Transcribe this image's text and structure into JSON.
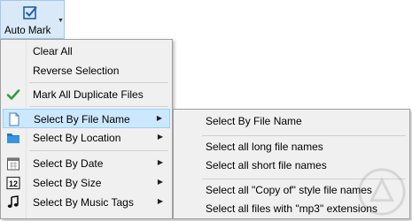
{
  "ribbon": {
    "auto_mark_label": "Auto Mark"
  },
  "menu": {
    "items": [
      {
        "label": "Clear All"
      },
      {
        "label": "Reverse Selection"
      },
      {
        "label": "Mark All Duplicate Files"
      },
      {
        "label": "Select By File Name"
      },
      {
        "label": "Select By Location"
      },
      {
        "label": "Select By Date"
      },
      {
        "label": "Select By Size"
      },
      {
        "label": "Select By Music Tags"
      }
    ]
  },
  "submenu": {
    "items": [
      {
        "label": "Select By File Name"
      },
      {
        "label": "Select all long file names"
      },
      {
        "label": "Select all short file names"
      },
      {
        "label": "Select all \"Copy of\" style file names"
      },
      {
        "label": "Select all files with \"mp3\" extensions"
      }
    ]
  },
  "colors": {
    "highlight": "#cce8ff",
    "highlight_border": "#99d1ff",
    "check_green": "#2e9e3e",
    "folder_blue": "#1e78c8"
  },
  "icons": [
    "checkbox-icon",
    "green-check-icon",
    "file-icon",
    "folder-icon",
    "calendar-icon",
    "size-12-icon",
    "music-note-icon"
  ]
}
